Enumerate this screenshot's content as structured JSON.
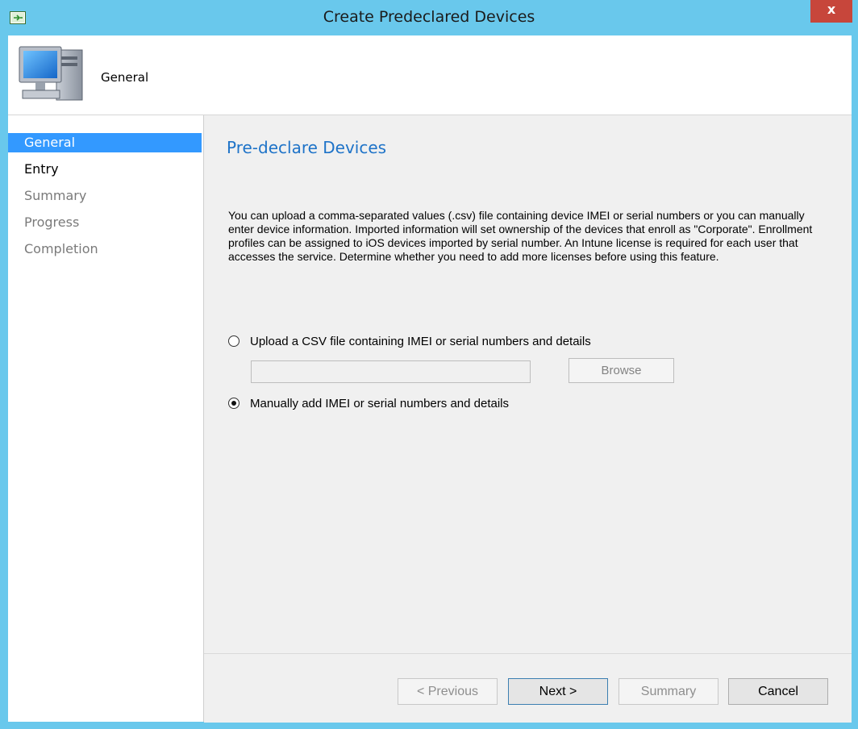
{
  "window": {
    "title": "Create Predeclared Devices",
    "close_label": "x"
  },
  "header": {
    "title": "General",
    "icon": "computer-icon"
  },
  "nav": {
    "items": [
      {
        "label": "General",
        "state": "active"
      },
      {
        "label": "Entry",
        "state": "normal"
      },
      {
        "label": "Summary",
        "state": "disabled"
      },
      {
        "label": "Progress",
        "state": "disabled"
      },
      {
        "label": "Completion",
        "state": "disabled"
      }
    ]
  },
  "content": {
    "title": "Pre-declare Devices",
    "description": "You can upload a comma-separated values (.csv) file containing device IMEI or serial numbers or you can manually enter device information.  Imported information will set ownership of the devices that enroll as \"Corporate\".  Enrollment profiles can be assigned to iOS devices imported by serial number.  An Intune license is required for each user that accesses the service.  Determine whether you need to add more licenses before using this feature.",
    "option_upload": "Upload a CSV file containing IMEI or serial numbers and details",
    "option_manual": "Manually add IMEI or serial numbers and details",
    "selected_option": "manual",
    "file_path": "",
    "browse_label": "Browse"
  },
  "footer": {
    "previous_label": "< Previous",
    "next_label": "Next >",
    "summary_label": "Summary",
    "cancel_label": "Cancel"
  },
  "colors": {
    "title_bar": "#69c8ec",
    "accent": "#3399ff",
    "heading": "#1e73c8",
    "close_button": "#c7463b"
  }
}
